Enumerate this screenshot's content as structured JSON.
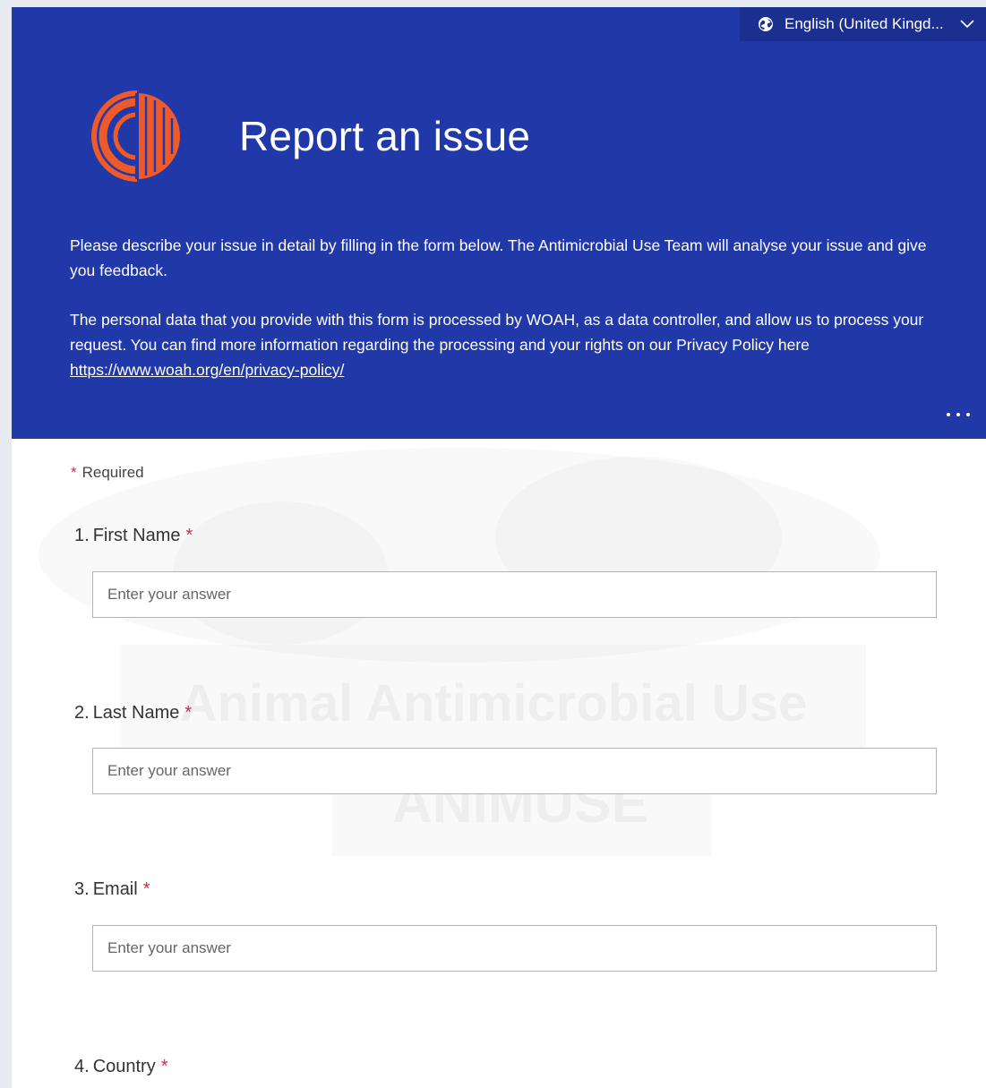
{
  "header": {
    "language_label": "English (United Kingd...",
    "title": "Report an issue",
    "description_paragraph_1": "Please describe your issue in detail by filling in the form below. The Antimicrobial Use Team will analyse your issue and give you feedback.",
    "description_paragraph_2_text": "The personal data that you provide with this form is processed by WOAH, as a data controller, and allow us  to process  your  request. You can find more information regarding the processing and your rights on our Privacy Policy here ",
    "privacy_link": "https://www.woah.org/en/privacy-policy/"
  },
  "form": {
    "required_note": "Required",
    "required_star": "*",
    "watermark_line_1": "Animal Antimicrobial Use",
    "watermark_line_2": "ANIMUSE",
    "questions": [
      {
        "number": "1.",
        "label": "First Name",
        "placeholder": "Enter your answer",
        "required_star": "*"
      },
      {
        "number": "2.",
        "label": "Last Name",
        "placeholder": "Enter your answer",
        "required_star": "*"
      },
      {
        "number": "3.",
        "label": "Email",
        "placeholder": "Enter your answer",
        "required_star": "*"
      },
      {
        "number": "4.",
        "label": "Country",
        "required_star": "*"
      }
    ]
  },
  "colors": {
    "header_background": "#2038a8",
    "language_button_background": "#1a2f8f",
    "logo_orange": "#f05a28",
    "required_red": "#c4314b"
  },
  "icons": {
    "language": "globe-icon",
    "language_dropdown": "chevron-down-icon",
    "logo": "animuse-logo-icon",
    "more": "more-options-icon"
  }
}
